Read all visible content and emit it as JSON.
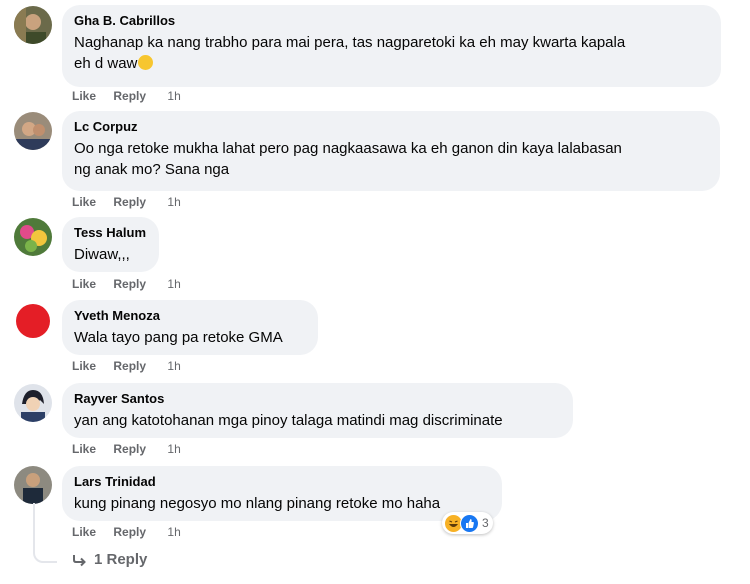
{
  "actions": {
    "like": "Like",
    "reply": "Reply"
  },
  "comments": [
    {
      "author": "Gha B. Cabrillos",
      "text_line1": "Naghanap ka nang trabho para mai pera, tas nagparetoki ka eh may kwarta kapala",
      "text_line2": "eh d waw",
      "time": "1h"
    },
    {
      "author": "Lc Corpuz",
      "text_line1": "Oo nga retoke mukha lahat pero pag nagkaasawa ka eh ganon din kaya lalabasan",
      "text_line2": "ng anak mo? Sana nga",
      "time": "1h"
    },
    {
      "author": "Tess Halum",
      "text_line1": "Diwaw,,,",
      "time": "1h"
    },
    {
      "author": "Yveth Menoza",
      "text_line1": "Wala tayo pang pa retoke GMA",
      "time": "1h"
    },
    {
      "author": "Rayver Santos",
      "text_line1": "yan ang katotohanan mga pinoy talaga matindi mag discriminate",
      "time": "1h"
    },
    {
      "author": "Lars Trinidad",
      "text_line1": "kung pinang negosyo mo nlang pinang retoke mo haha",
      "time": "1h"
    }
  ],
  "reactions": {
    "count": "3",
    "types": [
      "haha-icon",
      "like-icon"
    ]
  },
  "replies": {
    "label": "1 Reply"
  },
  "colors": {
    "bubble": "#f0f2f5",
    "meta": "#65676b",
    "like_blue": "#1877f2",
    "haha_yellow": "#f7b125",
    "avatar_red": "#e41e26"
  }
}
